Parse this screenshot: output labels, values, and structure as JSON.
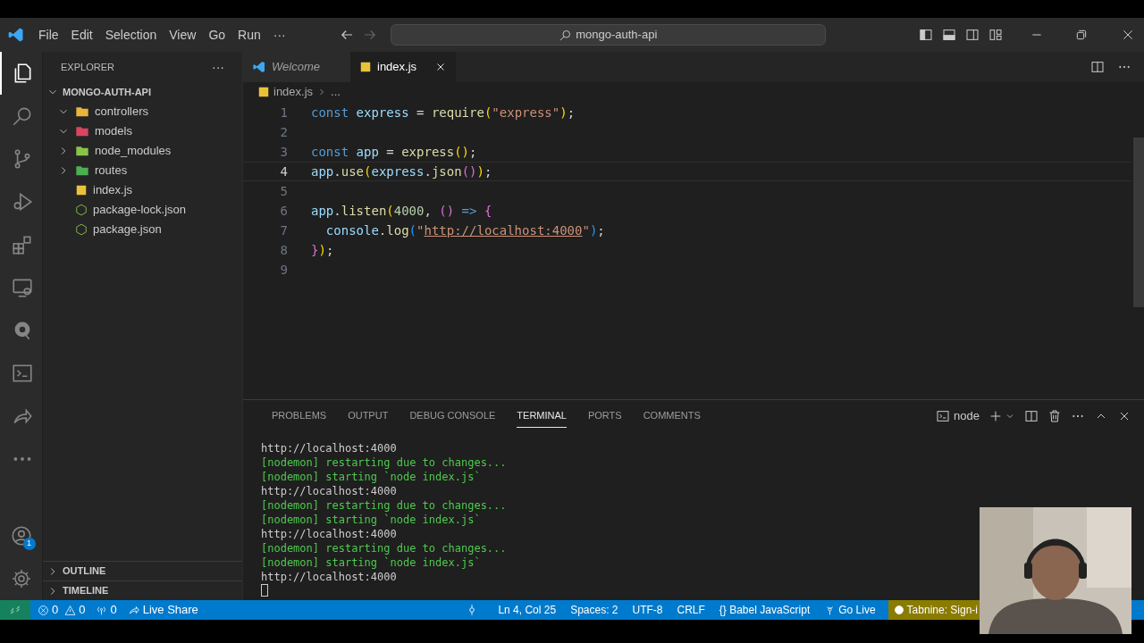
{
  "title_bar": {
    "menu": [
      "File",
      "Edit",
      "Selection",
      "View",
      "Go",
      "Run",
      "···"
    ],
    "search": "mongo-auth-api"
  },
  "activity_bar": {
    "items": [
      {
        "kind": "files",
        "selected": true
      },
      {
        "kind": "search",
        "selected": false
      },
      {
        "kind": "scm",
        "selected": false
      },
      {
        "kind": "debug",
        "selected": false
      },
      {
        "kind": "extensions",
        "selected": false
      },
      {
        "kind": "remote",
        "selected": false
      },
      {
        "kind": "q",
        "selected": false
      },
      {
        "kind": "terminal",
        "selected": false
      },
      {
        "kind": "share",
        "selected": false
      },
      {
        "kind": "more",
        "selected": false
      }
    ],
    "account_badge": "1"
  },
  "sidebar": {
    "title": "EXPLORER",
    "more": "···",
    "root": {
      "label": "MONGO-AUTH-API",
      "expanded": true
    },
    "items": [
      {
        "label": "controllers",
        "kind": "folder",
        "expanded": true,
        "color": "#e8b53a"
      },
      {
        "label": "models",
        "kind": "folder",
        "expanded": true,
        "color": "#d9455f"
      },
      {
        "label": "node_modules",
        "kind": "folder",
        "expanded": false,
        "color": "#8bc34a"
      },
      {
        "label": "routes",
        "kind": "folder",
        "expanded": false,
        "color": "#4caf50"
      },
      {
        "label": "index.js",
        "kind": "js"
      },
      {
        "label": "package-lock.json",
        "kind": "npm"
      },
      {
        "label": "package.json",
        "kind": "npm"
      }
    ],
    "sections": [
      {
        "label": "OUTLINE",
        "expanded": false
      },
      {
        "label": "TIMELINE",
        "expanded": false
      }
    ]
  },
  "tabs": [
    {
      "label": "Welcome",
      "kind": "welcome",
      "selected": false
    },
    {
      "label": "index.js",
      "kind": "js",
      "selected": true
    }
  ],
  "breadcrumb": [
    "index.js",
    "..."
  ],
  "editor": {
    "lines": [
      {
        "number": "1",
        "active": false,
        "tokens": [
          {
            "kind": "kw",
            "text": "const"
          },
          {
            "kind": "var",
            "text": " express"
          },
          {
            "kind": "p",
            "text": " = "
          },
          {
            "kind": "fn",
            "text": "require"
          },
          {
            "kind": "b1",
            "text": "("
          },
          {
            "kind": "str",
            "text": "\"express\""
          },
          {
            "kind": "b1",
            "text": ")"
          },
          {
            "kind": "p",
            "text": ";"
          }
        ]
      },
      {
        "number": "2",
        "active": false
      },
      {
        "number": "3",
        "active": false,
        "tokens": [
          {
            "kind": "kw",
            "text": "const"
          },
          {
            "kind": "var",
            "text": " app"
          },
          {
            "kind": "p",
            "text": " = "
          },
          {
            "kind": "fn",
            "text": "express"
          },
          {
            "kind": "b1",
            "text": "()"
          },
          {
            "kind": "p",
            "text": ";"
          }
        ]
      },
      {
        "number": "4",
        "active": true,
        "tokens": [
          {
            "kind": "var",
            "text": "app"
          },
          {
            "kind": "p",
            "text": "."
          },
          {
            "kind": "fn",
            "text": "use"
          },
          {
            "kind": "b1",
            "text": "("
          },
          {
            "kind": "var",
            "text": "express"
          },
          {
            "kind": "p",
            "text": "."
          },
          {
            "kind": "fn",
            "text": "json"
          },
          {
            "kind": "b2",
            "text": "()"
          },
          {
            "kind": "b1",
            "text": ")"
          },
          {
            "kind": "p",
            "text": ";"
          }
        ]
      },
      {
        "number": "5",
        "active": false
      },
      {
        "number": "6",
        "active": false,
        "tokens": [
          {
            "kind": "var",
            "text": "app"
          },
          {
            "kind": "p",
            "text": "."
          },
          {
            "kind": "fn",
            "text": "listen"
          },
          {
            "kind": "b1",
            "text": "("
          },
          {
            "kind": "num",
            "text": "4000"
          },
          {
            "kind": "p",
            "text": ", "
          },
          {
            "kind": "b2",
            "text": "()"
          },
          {
            "kind": "kw",
            "text": " =>"
          },
          {
            "kind": "b2",
            "text": " {"
          }
        ]
      },
      {
        "number": "7",
        "active": false,
        "tokens": [
          {
            "kind": "var",
            "text": "  console"
          },
          {
            "kind": "p",
            "text": "."
          },
          {
            "kind": "fn",
            "text": "log"
          },
          {
            "kind": "b3",
            "text": "("
          },
          {
            "kind": "str",
            "text": "\""
          },
          {
            "kind": "link",
            "text": "http://localhost:4000"
          },
          {
            "kind": "str",
            "text": "\""
          },
          {
            "kind": "b3",
            "text": ")"
          },
          {
            "kind": "p",
            "text": ";"
          }
        ]
      },
      {
        "number": "8",
        "active": false,
        "tokens": [
          {
            "kind": "b2",
            "text": "}"
          },
          {
            "kind": "b1",
            "text": ")"
          },
          {
            "kind": "p",
            "text": ";"
          }
        ]
      },
      {
        "number": "9",
        "active": false
      }
    ]
  },
  "panel": {
    "tabs": [
      {
        "label": "PROBLEMS",
        "selected": false
      },
      {
        "label": "OUTPUT",
        "selected": false
      },
      {
        "label": "DEBUG CONSOLE",
        "selected": false
      },
      {
        "label": "TERMINAL",
        "selected": true
      },
      {
        "label": "PORTS",
        "selected": false
      },
      {
        "label": "COMMENTS",
        "selected": false
      }
    ],
    "terminal_name": "node",
    "terminal": [
      {
        "kind": "plain",
        "text": "http://localhost:4000"
      },
      {
        "kind": "nodemon",
        "text": "[nodemon] restarting due to changes..."
      },
      {
        "kind": "nodemon",
        "text": "[nodemon] starting `node index.js`"
      },
      {
        "kind": "plain",
        "text": "http://localhost:4000"
      },
      {
        "kind": "nodemon",
        "text": "[nodemon] restarting due to changes..."
      },
      {
        "kind": "nodemon",
        "text": "[nodemon] starting `node index.js`"
      },
      {
        "kind": "plain",
        "text": "http://localhost:4000"
      },
      {
        "kind": "nodemon",
        "text": "[nodemon] restarting due to changes..."
      },
      {
        "kind": "nodemon",
        "text": "[nodemon] starting `node index.js`"
      },
      {
        "kind": "plain",
        "text": "http://localhost:4000"
      }
    ]
  },
  "status_bar": {
    "errors": "0",
    "warnings": "0",
    "ports": "0",
    "live_share": "Live Share",
    "right": [
      {
        "kind": "pin"
      },
      {
        "kind": "text",
        "text": "Ln 4, Col 25"
      },
      {
        "kind": "text",
        "text": "Spaces: 2"
      },
      {
        "kind": "text",
        "text": "UTF-8"
      },
      {
        "kind": "text",
        "text": "CRLF"
      },
      {
        "kind": "text",
        "text": "{} Babel JavaScript"
      },
      {
        "kind": "golive",
        "text": "Go Live"
      },
      {
        "kind": "tabnine",
        "text": "Tabnine: Sign-i"
      }
    ]
  },
  "webcam": {
    "kind": "picture"
  }
}
